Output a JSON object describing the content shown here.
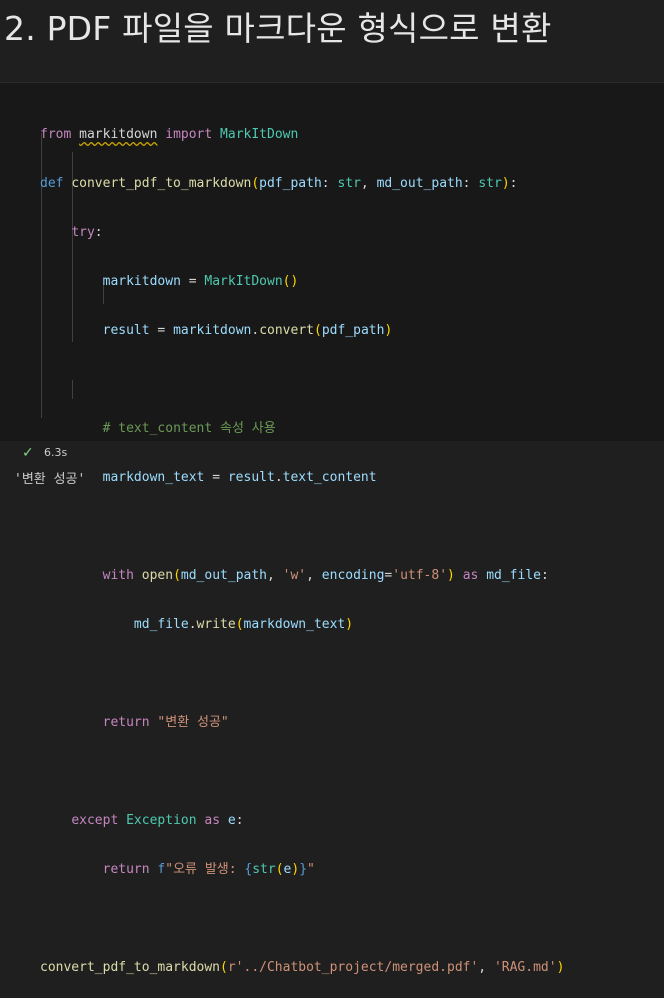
{
  "heading": "2. PDF 파일을 마크다운 형식으로 변환",
  "code": {
    "l1": {
      "k_from": "from",
      "mod": "markitdown",
      "k_import": "import",
      "name": "MarkItDown"
    },
    "l2": {
      "k_def": "def",
      "fn": "convert_pdf_to_markdown",
      "p_open": "(",
      "a1": "pdf_path",
      "colon1": ": ",
      "t1": "str",
      "comma": ", ",
      "a2": "md_out_path",
      "colon2": ": ",
      "t2": "str",
      "p_close": ")",
      "end": ":"
    },
    "l3": {
      "k_try": "try",
      "end": ":"
    },
    "l4": {
      "v": "markitdown",
      "op": " = ",
      "cls": "MarkItDown",
      "call": "()"
    },
    "l5": {
      "v": "result",
      "op": " = ",
      "obj": "markitdown",
      "dot": ".",
      "fn": "convert",
      "p_open": "(",
      "arg": "pdf_path",
      "p_close": ")"
    },
    "l7": {
      "comment": "# text_content 속성 사용"
    },
    "l8": {
      "v": "markdown_text",
      "op": " = ",
      "obj": "result",
      "dot": ".",
      "attr": "text_content"
    },
    "l10": {
      "k_with": "with",
      "fn": "open",
      "p_open": "(",
      "a1": "md_out_path",
      "c1": ", ",
      "s1": "'w'",
      "c2": ", ",
      "kwname": "encoding",
      "eq": "=",
      "s2": "'utf-8'",
      "p_close": ")",
      "k_as": " as ",
      "v": "md_file",
      "end": ":"
    },
    "l11": {
      "obj": "md_file",
      "dot": ".",
      "fn": "write",
      "p_open": "(",
      "arg": "markdown_text",
      "p_close": ")"
    },
    "l13": {
      "k_return": "return",
      "sp": " ",
      "s": "\"변환 성공\""
    },
    "l15": {
      "k_except": "except",
      "sp": " ",
      "cls": "Exception",
      "k_as": " as ",
      "v": "e",
      "end": ":"
    },
    "l16": {
      "k_return": "return",
      "sp": " ",
      "f": "f",
      "s_open": "\"오류 발생: ",
      "b_open": "{",
      "fn": "str",
      "p_open": "(",
      "v": "e",
      "p_close": ")",
      "b_close": "}",
      "s_close": "\""
    },
    "l18": {
      "fn": "convert_pdf_to_markdown",
      "p_open": "(",
      "s1": "r'../Chatbot_project/merged.pdf'",
      "c": ", ",
      "s2": "'RAG.md'",
      "p_close": ")"
    }
  },
  "status": {
    "check": "✓",
    "time": "6.3s"
  },
  "output": "'변환 성공'"
}
